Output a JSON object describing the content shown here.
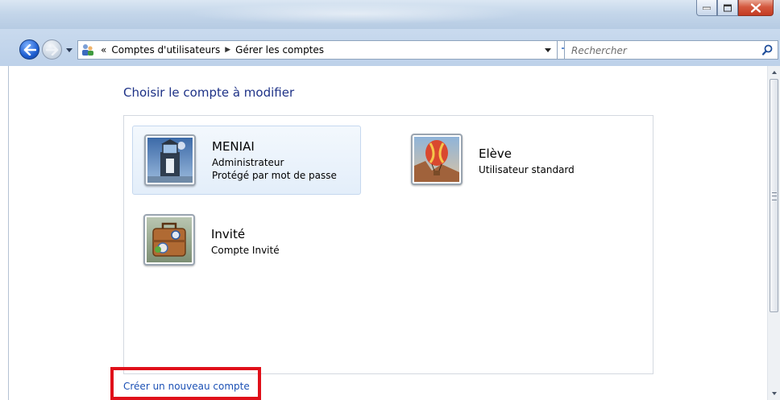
{
  "window": {
    "minimize_label": "Réduire",
    "maximize_label": "Agrandir",
    "close_label": "Fermer"
  },
  "nav": {
    "overflow": "«",
    "breadcrumb": [
      "Comptes d'utilisateurs",
      "Gérer les comptes"
    ],
    "search_placeholder": "Rechercher"
  },
  "page": {
    "title": "Choisir le compte à modifier",
    "create_link": "Créer un nouveau compte"
  },
  "accounts": [
    {
      "name": "MENIAI",
      "lines": [
        "Administrateur",
        "Protégé par mot de passe"
      ],
      "picture": "lighthouse",
      "selected": true
    },
    {
      "name": "Elève",
      "lines": [
        "Utilisateur standard"
      ],
      "picture": "hot-air-balloon",
      "selected": false
    },
    {
      "name": "Invité",
      "lines": [
        "Compte Invité"
      ],
      "picture": "suitcase",
      "selected": false
    }
  ],
  "colors": {
    "title_blue": "#1e3287",
    "link_blue": "#1b50b5",
    "highlight_red": "#e0101a"
  }
}
